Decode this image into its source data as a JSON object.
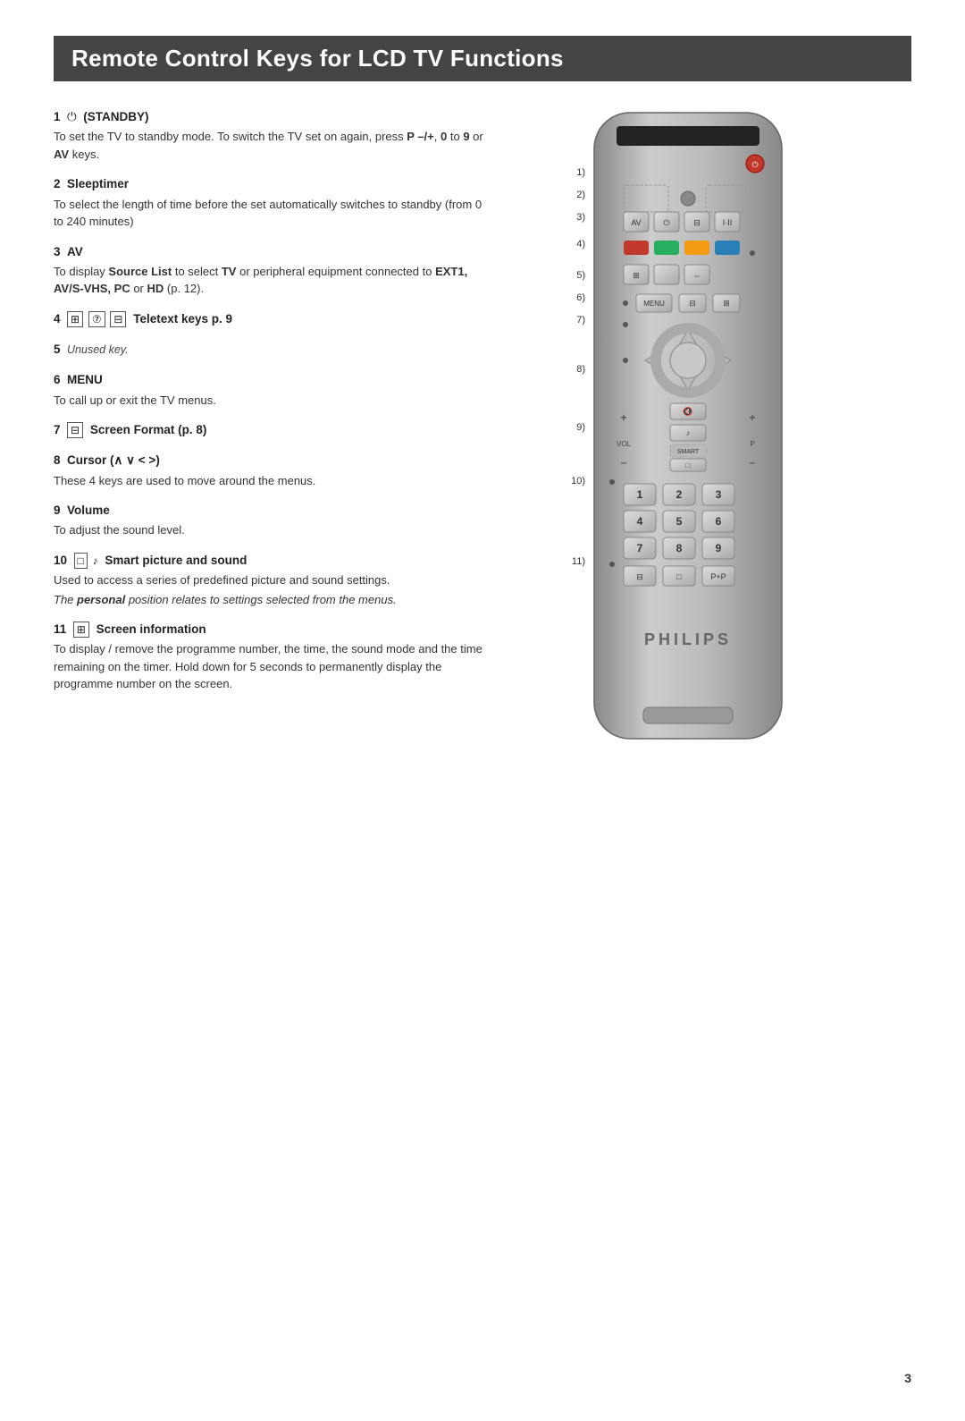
{
  "page": {
    "title": "Remote Control Keys for LCD TV Functions",
    "page_number": "3"
  },
  "sections": [
    {
      "number": "1",
      "title": "(STANDBY)",
      "icon": "⏻",
      "body": "To set the TV to standby mode. To switch the TV set on again, press P –/+, 0 to 9 or AV keys."
    },
    {
      "number": "2",
      "title": "Sleeptimer",
      "icon": "",
      "body": "To select the length of time before the set automatically switches to standby (from 0 to 240 minutes)"
    },
    {
      "number": "3",
      "title": "AV",
      "icon": "",
      "body_html": "To display Source List to select TV or peripheral equipment connected to EXT1, AV/S-VHS, PC or HD (p. 12)."
    },
    {
      "number": "4",
      "title": "Teletext keys p. 9",
      "icon": "⊞ ⑦ ⊟",
      "body": ""
    },
    {
      "number": "5",
      "title": "Unused key.",
      "italic": true,
      "body": ""
    },
    {
      "number": "6",
      "title": "MENU",
      "icon": "",
      "body": "To call up or exit the TV menus."
    },
    {
      "number": "7",
      "title": "Screen Format (p. 8)",
      "icon": "⊞",
      "body": ""
    },
    {
      "number": "8",
      "title": "Cursor (∧ ∨ < >)",
      "icon": "",
      "body": "These 4 keys are used to move around the menus."
    },
    {
      "number": "9",
      "title": "Volume",
      "icon": "",
      "body": "To adjust the sound level."
    },
    {
      "number": "10",
      "title": "Smart picture and sound",
      "icon": "□ ♪",
      "body": "Used to access a series of predefined picture and sound settings.",
      "italic_note": "The personal position relates to settings selected from the menus."
    },
    {
      "number": "11",
      "title": "Screen information",
      "icon": "⊞",
      "body": "To display / remove the programme number, the time, the sound mode and the time remaining on the timer. Hold down for 5 seconds to permanently display the programme number on the screen."
    }
  ]
}
